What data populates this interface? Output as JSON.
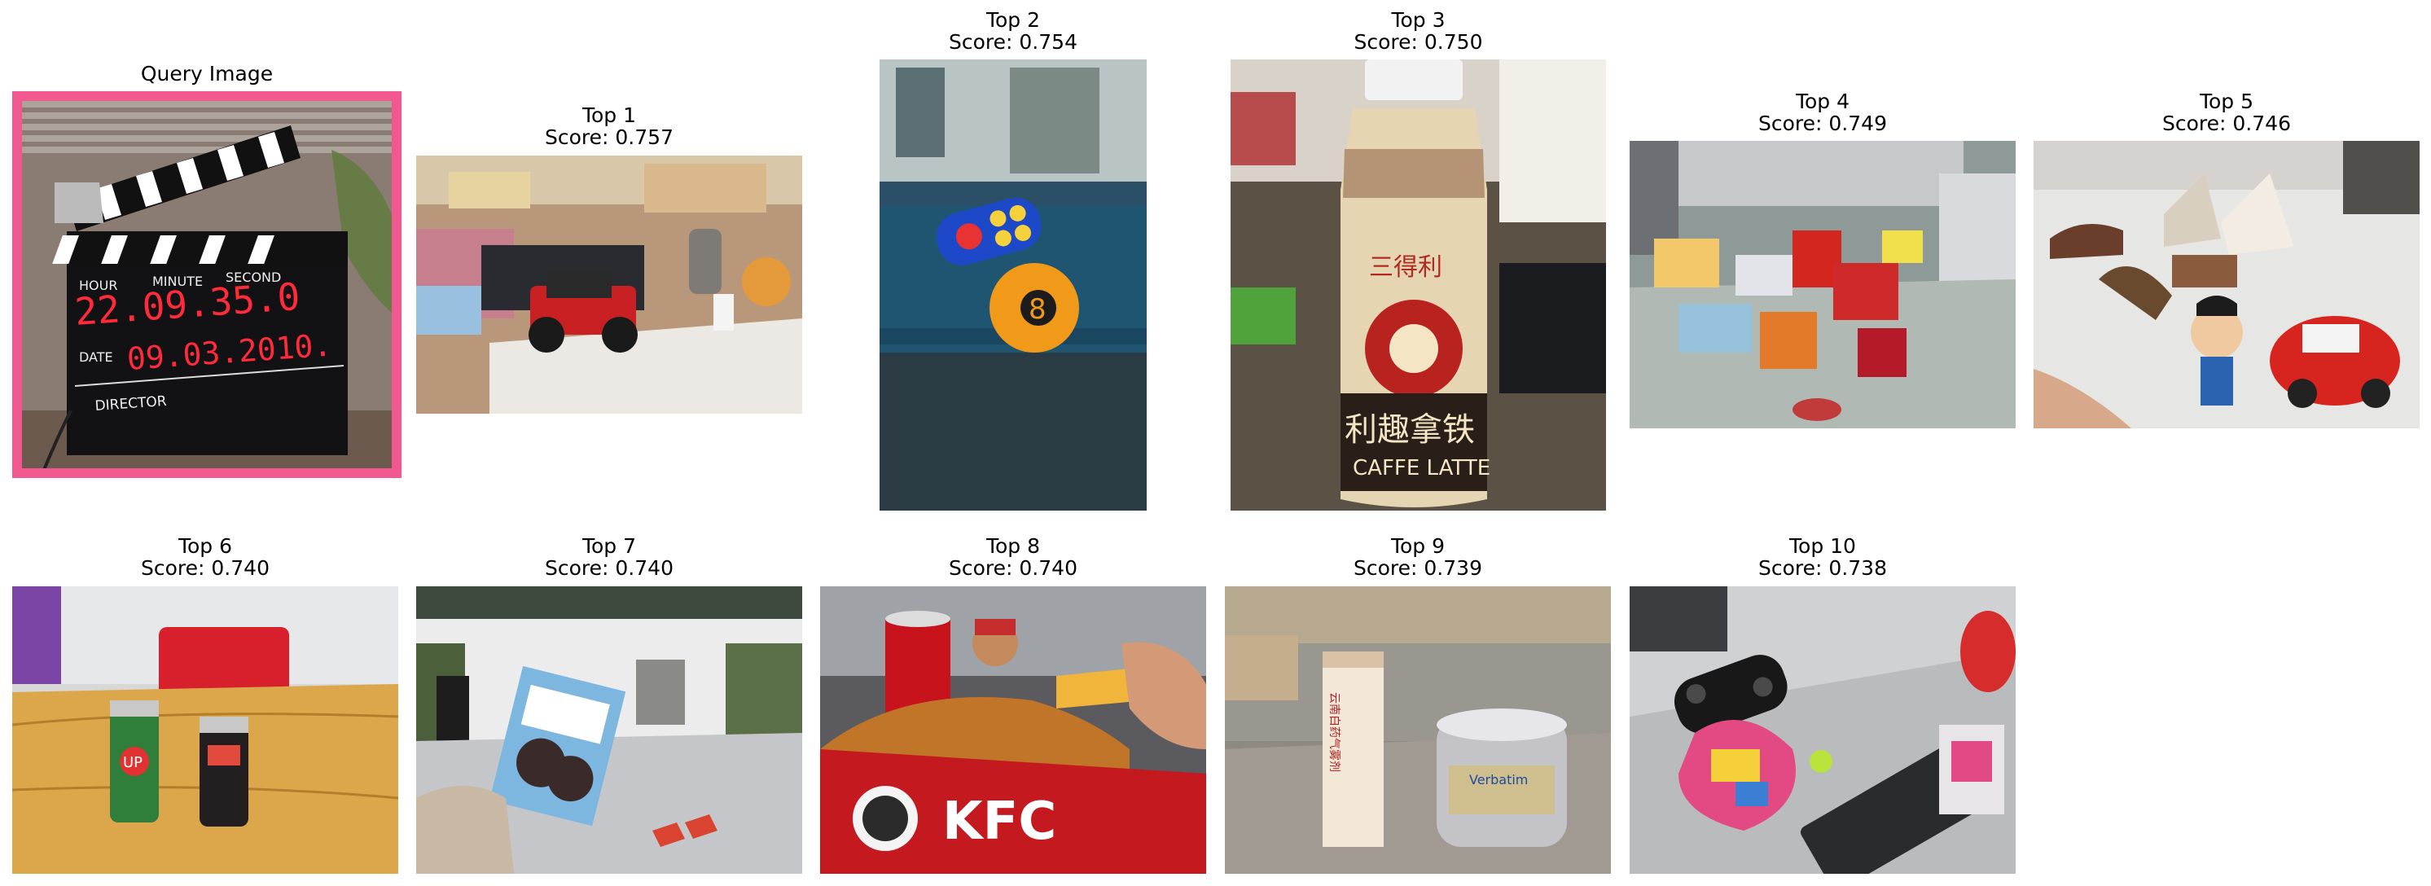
{
  "query": {
    "title": "Query Image"
  },
  "clapper": {
    "labels": {
      "hour": "HOUR",
      "minute": "MINUTE",
      "second": "SECOND",
      "date": "DATE",
      "director": "DIRECTOR"
    },
    "time": "22.09.35.0",
    "date": "09.03.2010."
  },
  "results": [
    {
      "rank": "Top 1",
      "score": "Score: 0.757"
    },
    {
      "rank": "Top 2",
      "score": "Score: 0.754"
    },
    {
      "rank": "Top 3",
      "score": "Score: 0.750"
    },
    {
      "rank": "Top 4",
      "score": "Score: 0.749"
    },
    {
      "rank": "Top 5",
      "score": "Score: 0.746"
    },
    {
      "rank": "Top 6",
      "score": "Score: 0.740"
    },
    {
      "rank": "Top 7",
      "score": "Score: 0.740"
    },
    {
      "rank": "Top 8",
      "score": "Score: 0.740"
    },
    {
      "rank": "Top 9",
      "score": "Score: 0.739"
    },
    {
      "rank": "Top 10",
      "score": "Score: 0.738"
    }
  ],
  "photo_text": {
    "bottle_brand": "三得利",
    "bottle_name": "利趣拿铁",
    "bottle_latin": "CAFFE LATTE",
    "kfc": "KFC",
    "can": "UP",
    "verbatim": "Verbatim",
    "box": "云南白药气雾剂"
  },
  "colors": {
    "query_border": "#f0588f",
    "led": "#ff2a3a"
  }
}
